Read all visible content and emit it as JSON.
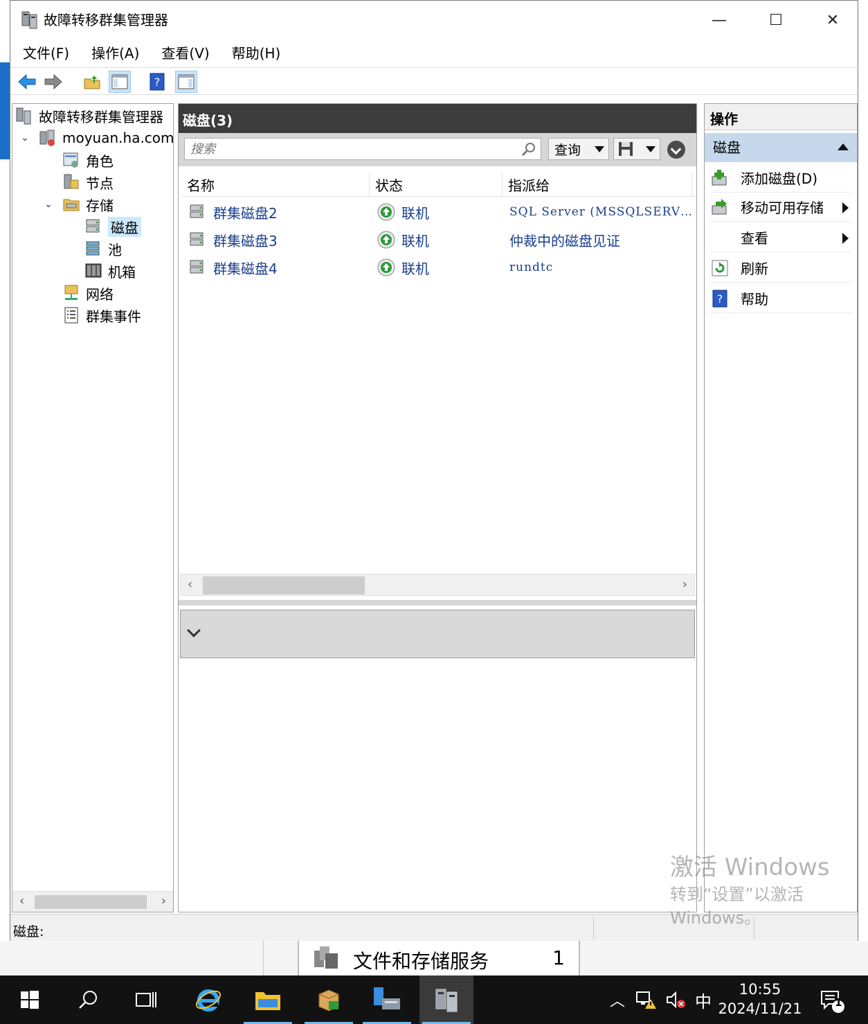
{
  "window": {
    "title": "故障转移群集管理器",
    "minimize": "—",
    "maximize": "☐",
    "close": "✕"
  },
  "menu": [
    "文件(F)",
    "操作(A)",
    "查看(V)",
    "帮助(H)"
  ],
  "tree": {
    "root": "故障转移群集管理器",
    "cluster": "moyuan.ha.com",
    "roles": "角色",
    "nodes": "节点",
    "storage": "存储",
    "disks": "磁盘",
    "pools": "池",
    "enclosures": "机箱",
    "networks": "网络",
    "events": "群集事件"
  },
  "center": {
    "title": "磁盘(3)",
    "search_placeholder": "搜索",
    "query_label": "查询",
    "columns": [
      "名称",
      "状态",
      "指派给"
    ],
    "rows": [
      {
        "name": "群集磁盘2",
        "status": "联机",
        "assigned": "SQL Server (MSSQLSERV…"
      },
      {
        "name": "群集磁盘3",
        "status": "联机",
        "assigned": "仲裁中的磁盘见证"
      },
      {
        "name": "群集磁盘4",
        "status": "联机",
        "assigned": "rundtc"
      }
    ]
  },
  "actions": {
    "header": "操作",
    "section": "磁盘",
    "items": [
      "添加磁盘(D)",
      "移动可用存储",
      "查看",
      "刷新",
      "帮助"
    ]
  },
  "status_bar": {
    "text": "磁盘:"
  },
  "watermark": {
    "line1": "激活 Windows",
    "line2": "转到“设置”以激活",
    "line3": "Windows。"
  },
  "server_manager_tile": {
    "label": "文件和存储服务",
    "count": "1"
  },
  "taskbar": {
    "ime": "中",
    "time": "10:55",
    "date": "2024/11/21",
    "notification_count": "1"
  },
  "colors": {
    "accent": "#1a3e8c",
    "selection": "#cce8ff",
    "header_dark": "#3c3c3c",
    "taskbar": "#121212"
  }
}
